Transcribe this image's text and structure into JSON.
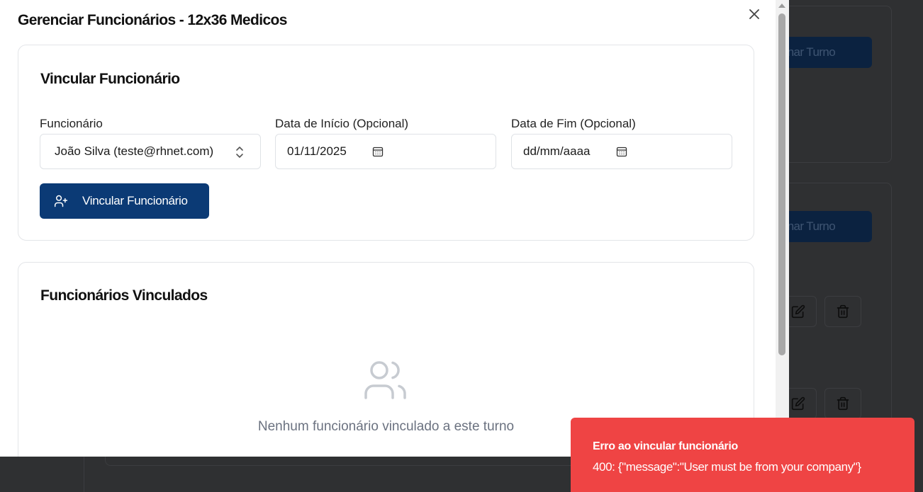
{
  "background": {
    "buttons": [
      {
        "label": "Adicionar Turno"
      },
      {
        "label": "Adicionar Turno"
      }
    ],
    "icons": [
      "edit-icon",
      "trash-icon",
      "edit-icon",
      "trash-icon"
    ]
  },
  "dialog": {
    "title": "Gerenciar Funcionários - 12x36 Medicos",
    "close_icon": "close-icon",
    "link_section": {
      "title": "Vincular Funcionário",
      "employee_label": "Funcionário",
      "employee_value": "João Silva (teste@rhnet.com)",
      "start_label": "Data de Início (Opcional)",
      "start_value": "01/11/2025",
      "end_label": "Data de Fim (Opcional)",
      "end_placeholder": "dd/mm/aaaa",
      "button_label": "Vincular Funcionário",
      "button_icon": "user-plus-icon"
    },
    "linked_section": {
      "title": "Funcionários Vinculados",
      "empty_icon": "users-icon",
      "empty_text": "Nenhum funcionário vinculado a este turno"
    }
  },
  "toast": {
    "title": "Erro ao vincular funcionário",
    "message": "400: {\"message\":\"User must be from your company\"}",
    "color": "#ef4444"
  },
  "colors": {
    "primary": "#0b3a75",
    "error": "#ef4444"
  }
}
